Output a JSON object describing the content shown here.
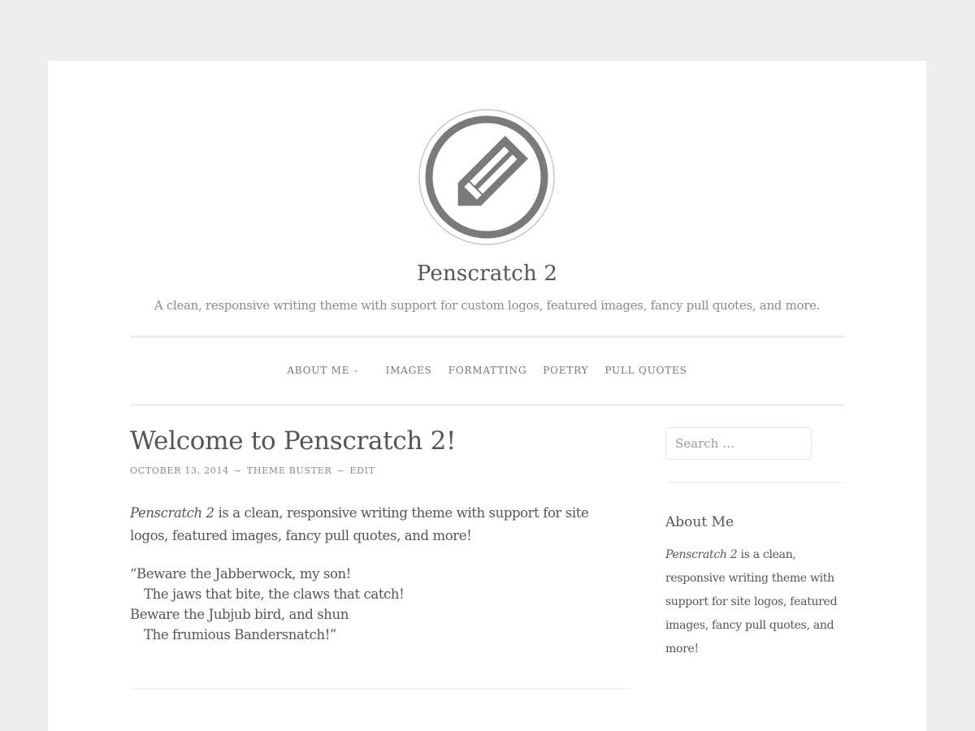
{
  "site": {
    "title": "Penscratch 2",
    "tagline": "A clean, responsive writing theme with support for custom logos, featured images, fancy pull quotes, and more.",
    "logo_icon": "pencil-in-circle"
  },
  "nav": {
    "items": [
      {
        "label": "ABOUT ME",
        "has_submenu": true,
        "submenu_icon": "chevron-down"
      },
      {
        "label": "IMAGES"
      },
      {
        "label": "FORMATTING"
      },
      {
        "label": "POETRY"
      },
      {
        "label": "PULL QUOTES"
      }
    ]
  },
  "post": {
    "title": "Welcome to Penscratch 2!",
    "date": "OCTOBER 13, 2014",
    "separator": "~",
    "author": "THEME BUSTER",
    "edit_label": "EDIT",
    "intro_em": "Penscratch 2",
    "intro_rest": " is a clean, responsive writing theme with support for site logos, featured images, fancy pull quotes, and more!",
    "poem": [
      {
        "text": "“Beware the Jabberwock, my son!",
        "indent": false
      },
      {
        "text": "The jaws that bite, the claws that catch!",
        "indent": true
      },
      {
        "text": "Beware the Jubjub bird, and shun",
        "indent": false
      },
      {
        "text": "The frumious Bandersnatch!”",
        "indent": true
      }
    ]
  },
  "sidebar": {
    "search_placeholder": "Search …",
    "search_value": "",
    "widget_title": "About Me",
    "widget_em": "Penscratch 2",
    "widget_rest": " is a clean, responsive writing theme with support for site logos, featured images, fancy pull quotes, and more!"
  },
  "colors": {
    "background": "#eeeeee",
    "page": "#ffffff",
    "text": "#555555",
    "muted": "#888888",
    "logo": "#7a7a7a"
  }
}
